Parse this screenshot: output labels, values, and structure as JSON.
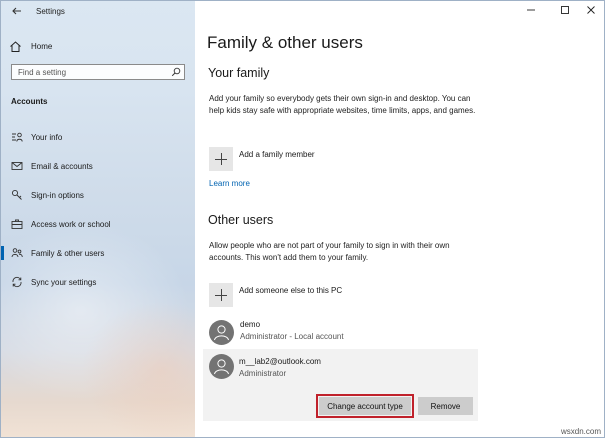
{
  "window": {
    "app_title": "Settings",
    "controls": {
      "minimize": "—",
      "maximize": "☐",
      "close": "✕"
    }
  },
  "sidebar": {
    "home_label": "Home",
    "search_placeholder": "Find a setting",
    "section_label": "Accounts",
    "items": [
      {
        "label": "Your info",
        "icon": "person-card-icon"
      },
      {
        "label": "Email & accounts",
        "icon": "envelope-icon"
      },
      {
        "label": "Sign-in options",
        "icon": "key-icon"
      },
      {
        "label": "Access work or school",
        "icon": "briefcase-icon"
      },
      {
        "label": "Family & other users",
        "icon": "people-icon",
        "active": true
      },
      {
        "label": "Sync your settings",
        "icon": "sync-icon"
      }
    ]
  },
  "main": {
    "title": "Family & other users",
    "family": {
      "heading": "Your family",
      "description": "Add your family so everybody gets their own sign-in and desktop. You can help kids stay safe with appropriate websites, time limits, apps, and games.",
      "add_label": "Add a family member",
      "learn_more": "Learn more"
    },
    "other": {
      "heading": "Other users",
      "description": "Allow people who are not part of your family to sign in with their own accounts. This won't add them to your family.",
      "add_label": "Add someone else to this PC",
      "users": [
        {
          "name": "demo",
          "role": "Administrator - Local account"
        },
        {
          "name": "m__lab2@outlook.com",
          "role": "Administrator"
        }
      ],
      "change_type_button": "Change account type",
      "remove_button": "Remove"
    }
  },
  "accent_color": "#0063b1",
  "highlight_color": "#c0212b",
  "watermark": "wsxdn.com"
}
